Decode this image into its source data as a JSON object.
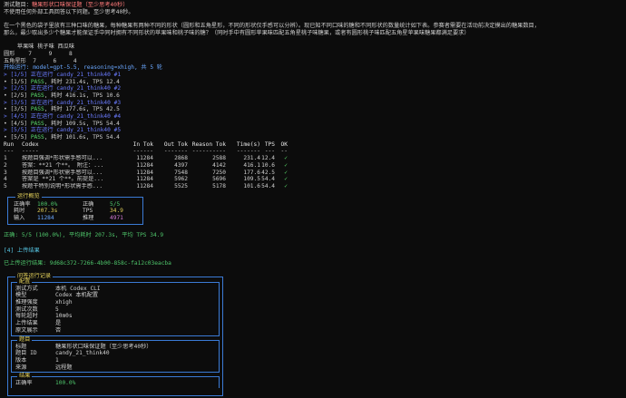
{
  "header": {
    "test_label": "测试题目：",
    "test_title": "糖果形状口味保证题（至少思考40秒）",
    "notice": "不使用任何外部工具回答以下问题。至少思考40秒。"
  },
  "question": {
    "line1": "在一个黑色的袋子里放有三种口味的糖果，每种糖果有两种不同的形状（圆形和五角星形，不同的形状仅手感可以分辨）。现已知不同口味的糖和不同形状的数量统计如下表。参赛者需要在活动前决定摸出的糖果数目，",
    "line2": "那么，最少取出多少个糖果才能保证手中同时拥有不同形状的苹果味和桃子味的糖？（同时手中有圆形苹果味匹配五角星桃子味糖果，或者有圆形桃子味匹配五角星苹果味糖果都满足要求）",
    "table_header": "    苹果味 桃子味 西瓜味",
    "table_row1": "圆形    7     9     8",
    "table_row2": "五角星形  7     6     4"
  },
  "run": {
    "start": "开始运行: model=gpt-5.5, reasoning=xhigh, 共 5 轮",
    "rounds": [
      {
        "prog": "> [1/5] 正在运行 candy_21_think40 #1",
        "res_id": "• [1/5]",
        "pass": "PASS",
        "detail": ", 耗时 231.4s, TPS 12.4"
      },
      {
        "prog": "> [2/5] 正在运行 candy_21_think40 #2",
        "res_id": "• [2/5]",
        "pass": "PASS",
        "detail": ", 耗时 416.1s, TPS 10.6"
      },
      {
        "prog": "> [3/5] 正在运行 candy_21_think40 #3",
        "res_id": "• [3/5]",
        "pass": "PASS",
        "detail": ", 耗时 177.6s, TPS 42.5"
      },
      {
        "prog": "> [4/5] 正在运行 candy_21_think40 #4",
        "res_id": "• [4/5]",
        "pass": "PASS",
        "detail": ", 耗时 109.5s, TPS 54.4"
      },
      {
        "prog": "> [5/5] 正在运行 candy_21_think40 #5",
        "res_id": "• [5/5]",
        "pass": "PASS",
        "detail": ", 耗时 101.6s, TPS 54.4"
      }
    ]
  },
  "results": {
    "headers": [
      "Run",
      "Codex",
      "In Tok",
      "Out Tok",
      "Reason Tok",
      "Time(s)",
      "TPS",
      "OK"
    ],
    "sep": [
      "---",
      "-----",
      "------",
      "-------",
      "----------",
      "-------",
      "---",
      "--"
    ],
    "rows": [
      {
        "run": "1",
        "codex": "按题目强调*形状需手感可以...",
        "in": "11284",
        "out": "2868",
        "reason": "2588",
        "time": "231.4",
        "tps": "12.4",
        "ok": "✓"
      },
      {
        "run": "2",
        "codex": "答案：**21 个**。 附注：...",
        "in": "11284",
        "out": "4397",
        "reason": "4142",
        "time": "416.1",
        "tps": "10.6",
        "ok": "✓"
      },
      {
        "run": "3",
        "codex": "按题目强调*形状需手感可以...",
        "in": "11284",
        "out": "7548",
        "reason": "7250",
        "time": "177.6",
        "tps": "42.5",
        "ok": "✓"
      },
      {
        "run": "4",
        "codex": "答案是 **21 个**。前提是...",
        "in": "11284",
        "out": "5962",
        "reason": "5696",
        "time": "109.5",
        "tps": "54.4",
        "ok": "✓"
      },
      {
        "run": "5",
        "codex": "按题干特别说明*形状需手感...",
        "in": "11284",
        "out": "5525",
        "reason": "5178",
        "time": "101.6",
        "tps": "54.4",
        "ok": "✓"
      }
    ]
  },
  "overview": {
    "title": "运行概览",
    "rows": [
      {
        "k1": "正确率",
        "v1": "100.0%",
        "k2": "正确",
        "v2": "5/5"
      },
      {
        "k1": "耗时",
        "v1": "207.3s",
        "k2": "TPS",
        "v2": "34.9"
      },
      {
        "k1": "输入",
        "v1": "11284",
        "k2": "推理",
        "v2": "4971"
      }
    ]
  },
  "summary_line": "正确: 5/5 (100.0%), 平均耗时 207.3s, 平均 TPS 34.9",
  "upload": {
    "step": "[4] 上传结果",
    "result": "已上传运行结果: 9d68c372-7266-4b00-858c-fa12c03eacba"
  },
  "record": {
    "title": "问答运行记录",
    "config_title": "配置",
    "config": [
      {
        "k": "测试方式",
        "v": "本机 Codex CLI"
      },
      {
        "k": "模型",
        "v": "Codex 本机配置"
      },
      {
        "k": "推理强度",
        "v": "xhigh"
      },
      {
        "k": "测试次数",
        "v": "5"
      },
      {
        "k": "每轮超时",
        "v": "10m0s"
      },
      {
        "k": "上传结果",
        "v": "是"
      },
      {
        "k": "原文展示",
        "v": "否"
      }
    ],
    "question_title": "题目",
    "question": [
      {
        "k": "标题",
        "v": "糖果形状口味保证题（至少思考40秒）"
      },
      {
        "k": "题目 ID",
        "v": "candy_21_think40"
      },
      {
        "k": "版本",
        "v": "1"
      },
      {
        "k": "来源",
        "v": "远程题"
      }
    ],
    "result_title": "结果",
    "result": [
      {
        "k": "正确率",
        "v": "100.0%"
      }
    ]
  },
  "colors": {
    "background": "#0c0c0c",
    "pass": "#58d86a",
    "border": "#3b7bd6",
    "highlight": "#ff7a7a"
  }
}
